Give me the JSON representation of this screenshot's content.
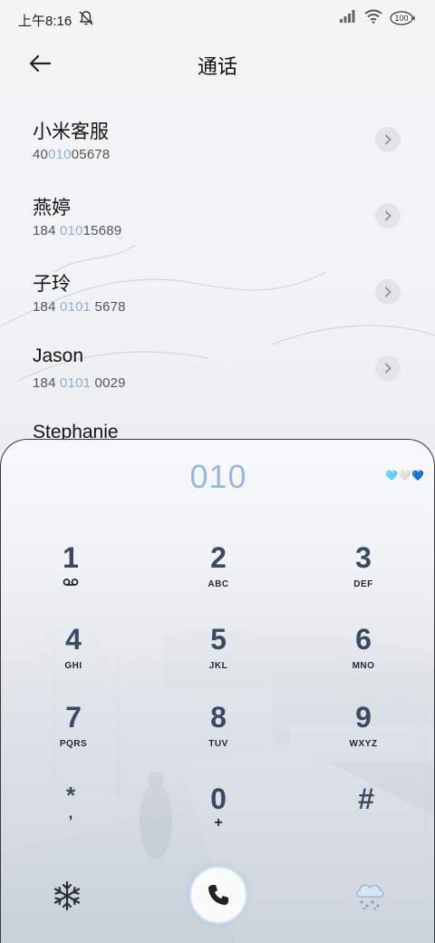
{
  "status_bar": {
    "time": "上午8:16",
    "battery": "100",
    "icons": [
      "mute-bell-icon",
      "signal-icon",
      "wifi-icon",
      "battery-icon"
    ]
  },
  "header": {
    "title": "通话",
    "back_icon": "back-arrow-icon"
  },
  "contacts": [
    {
      "name": "小米客服",
      "number_pre": "40",
      "number_hl": "010",
      "number_post": "05678"
    },
    {
      "name": "燕婷",
      "number_pre": "184 ",
      "number_hl": "010",
      "number_post": "15689"
    },
    {
      "name": "子玲",
      "number_pre": "184 ",
      "number_hl": "0101",
      "number_post": " 5678"
    },
    {
      "name": "Jason",
      "number_pre": "184 ",
      "number_hl": "0101",
      "number_post": " 0029"
    },
    {
      "name": "Stephanie"
    }
  ],
  "dialpad": {
    "dialed": "010",
    "hearts": [
      "🩵",
      "🤍",
      "💙"
    ],
    "keys": [
      {
        "digit": "1",
        "letters": ""
      },
      {
        "digit": "2",
        "letters": "ABC"
      },
      {
        "digit": "3",
        "letters": "DEF"
      },
      {
        "digit": "4",
        "letters": "GHI"
      },
      {
        "digit": "5",
        "letters": "JKL"
      },
      {
        "digit": "6",
        "letters": "MNO"
      },
      {
        "digit": "7",
        "letters": "PQRS"
      },
      {
        "digit": "8",
        "letters": "TUV"
      },
      {
        "digit": "9",
        "letters": "WXYZ"
      },
      {
        "digit": "*",
        "letters": ","
      },
      {
        "digit": "0",
        "letters": "+"
      },
      {
        "digit": "#",
        "letters": ""
      }
    ],
    "key1_icon": "voicemail-icon",
    "bottom_left_icon": "snowflake-icon",
    "call_icon": "phone-icon",
    "bottom_right_icon": "weather-snow-icon"
  },
  "colors": {
    "accent": "#9ab7de",
    "digit": "#3b4a63",
    "highlight": "#8cb0d8"
  }
}
